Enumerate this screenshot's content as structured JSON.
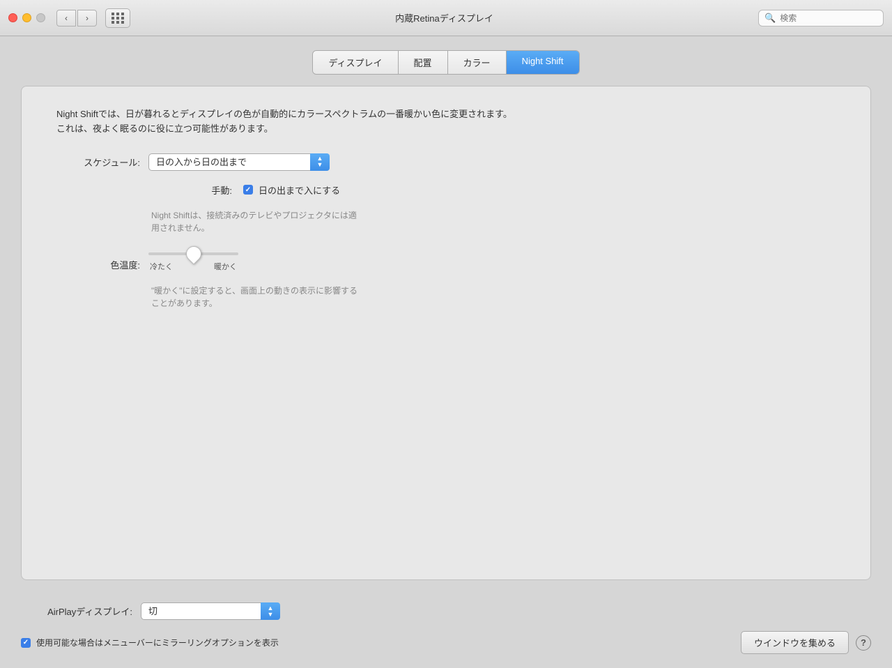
{
  "titlebar": {
    "title": "内蔵Retinaディスプレイ",
    "search_placeholder": "検索"
  },
  "tabs": {
    "items": [
      {
        "id": "display",
        "label": "ディスプレイ",
        "active": false
      },
      {
        "id": "arrangement",
        "label": "配置",
        "active": false
      },
      {
        "id": "color",
        "label": "カラー",
        "active": false
      },
      {
        "id": "nightshift",
        "label": "Night Shift",
        "active": true
      }
    ]
  },
  "nightshift": {
    "description": "Night Shiftでは、日が暮れるとディスプレイの色が自動的にカラースペクトラムの一番暖かい色に変更されます。これは、夜よく眠るのに役に立つ可能性があります。",
    "schedule_label": "スケジュール:",
    "schedule_value": "日の入から日の出まで",
    "manual_label": "手動:",
    "manual_checkbox_text": "日の出まで入にする",
    "manual_checked": true,
    "note_text": "Night Shiftは、接続済みのテレビやプロジェクタには適用されません。",
    "color_temp_label": "色温度:",
    "temp_cold_label": "冷たく",
    "temp_warm_label": "暖かく",
    "temp_note": "\"暖かく\"に設定すると、画面上の動きの表示に影響することがあります。",
    "slider_value": 50
  },
  "airplay": {
    "label": "AirPlayディスプレイ:",
    "value": "切"
  },
  "bottom": {
    "mirror_checkbox_text": "使用可能な場合はメニューバーにミラーリングオプションを表示",
    "mirror_checked": true,
    "gather_btn_label": "ウインドウを集める",
    "help_btn_label": "?"
  }
}
